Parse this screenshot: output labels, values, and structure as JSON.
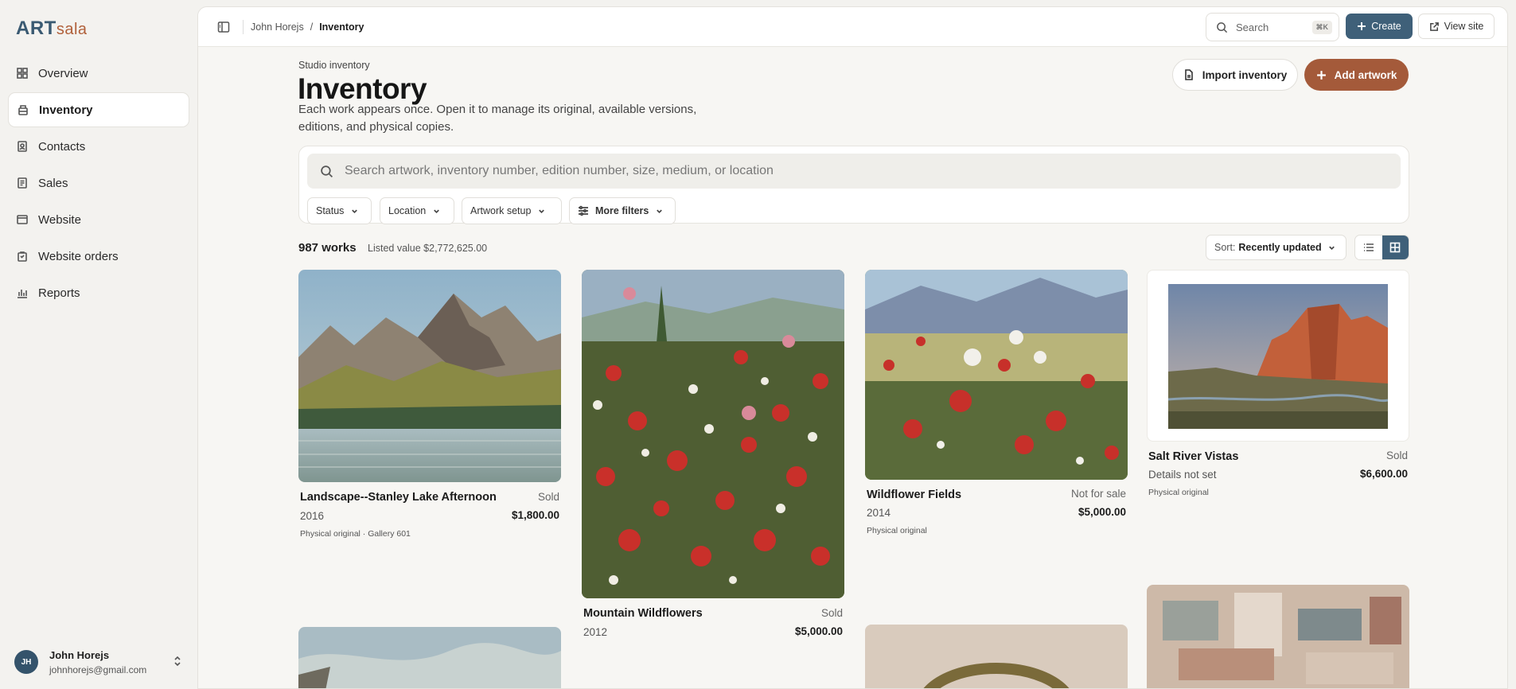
{
  "brand": {
    "name": "ART",
    "suffix": "sala"
  },
  "nav": [
    {
      "label": "Overview",
      "icon": "grid-icon"
    },
    {
      "label": "Inventory",
      "icon": "box-icon",
      "active": true
    },
    {
      "label": "Contacts",
      "icon": "contact-card-icon"
    },
    {
      "label": "Sales",
      "icon": "receipt-icon"
    },
    {
      "label": "Website",
      "icon": "browser-icon"
    },
    {
      "label": "Website orders",
      "icon": "bag-icon"
    },
    {
      "label": "Reports",
      "icon": "bar-chart-icon"
    }
  ],
  "user": {
    "initials": "JH",
    "name": "John Horejs",
    "email": "johnhorejs@gmail.com"
  },
  "topbar": {
    "breadcrumb": [
      "John Horejs",
      "Inventory"
    ],
    "separator": "/",
    "search_label": "Search",
    "search_shortcut": "⌘K",
    "create_label": "Create",
    "view_site_label": "View site"
  },
  "header": {
    "eyebrow": "Studio inventory",
    "title": "Inventory",
    "description": "Each work appears once. Open it to manage its original, available versions, editions, and physical copies.",
    "import_label": "Import inventory",
    "add_label": "Add artwork"
  },
  "filters": {
    "search_placeholder": "Search artwork, inventory number, edition number, size, medium, or location",
    "chips": [
      "Status",
      "Location",
      "Artwork setup",
      "More filters"
    ]
  },
  "summary": {
    "count": "987 works",
    "listed_value": "Listed value $2,772,625.00",
    "sort_prefix": "Sort:",
    "sort_value": "Recently updated"
  },
  "colors": {
    "accent": "#3f6079",
    "brand_secondary": "#a45a3a"
  },
  "artworks": [
    {
      "title": "Landscape--Stanley Lake Afternoon",
      "status": "Sold",
      "year": "2016",
      "price": "$1,800.00",
      "meta": "Physical original · Gallery 601"
    },
    {
      "title": "Mountain Wildflowers",
      "status": "Sold",
      "year": "2012",
      "price": "$5,000.00",
      "meta": ""
    },
    {
      "title": "Wildflower Fields",
      "status": "Not for sale",
      "year": "2014",
      "price": "$5,000.00",
      "meta": "Physical original"
    },
    {
      "title": "Salt River Vistas",
      "status": "Sold",
      "year": "Details not set",
      "price": "$6,600.00",
      "meta": "Physical original"
    }
  ]
}
